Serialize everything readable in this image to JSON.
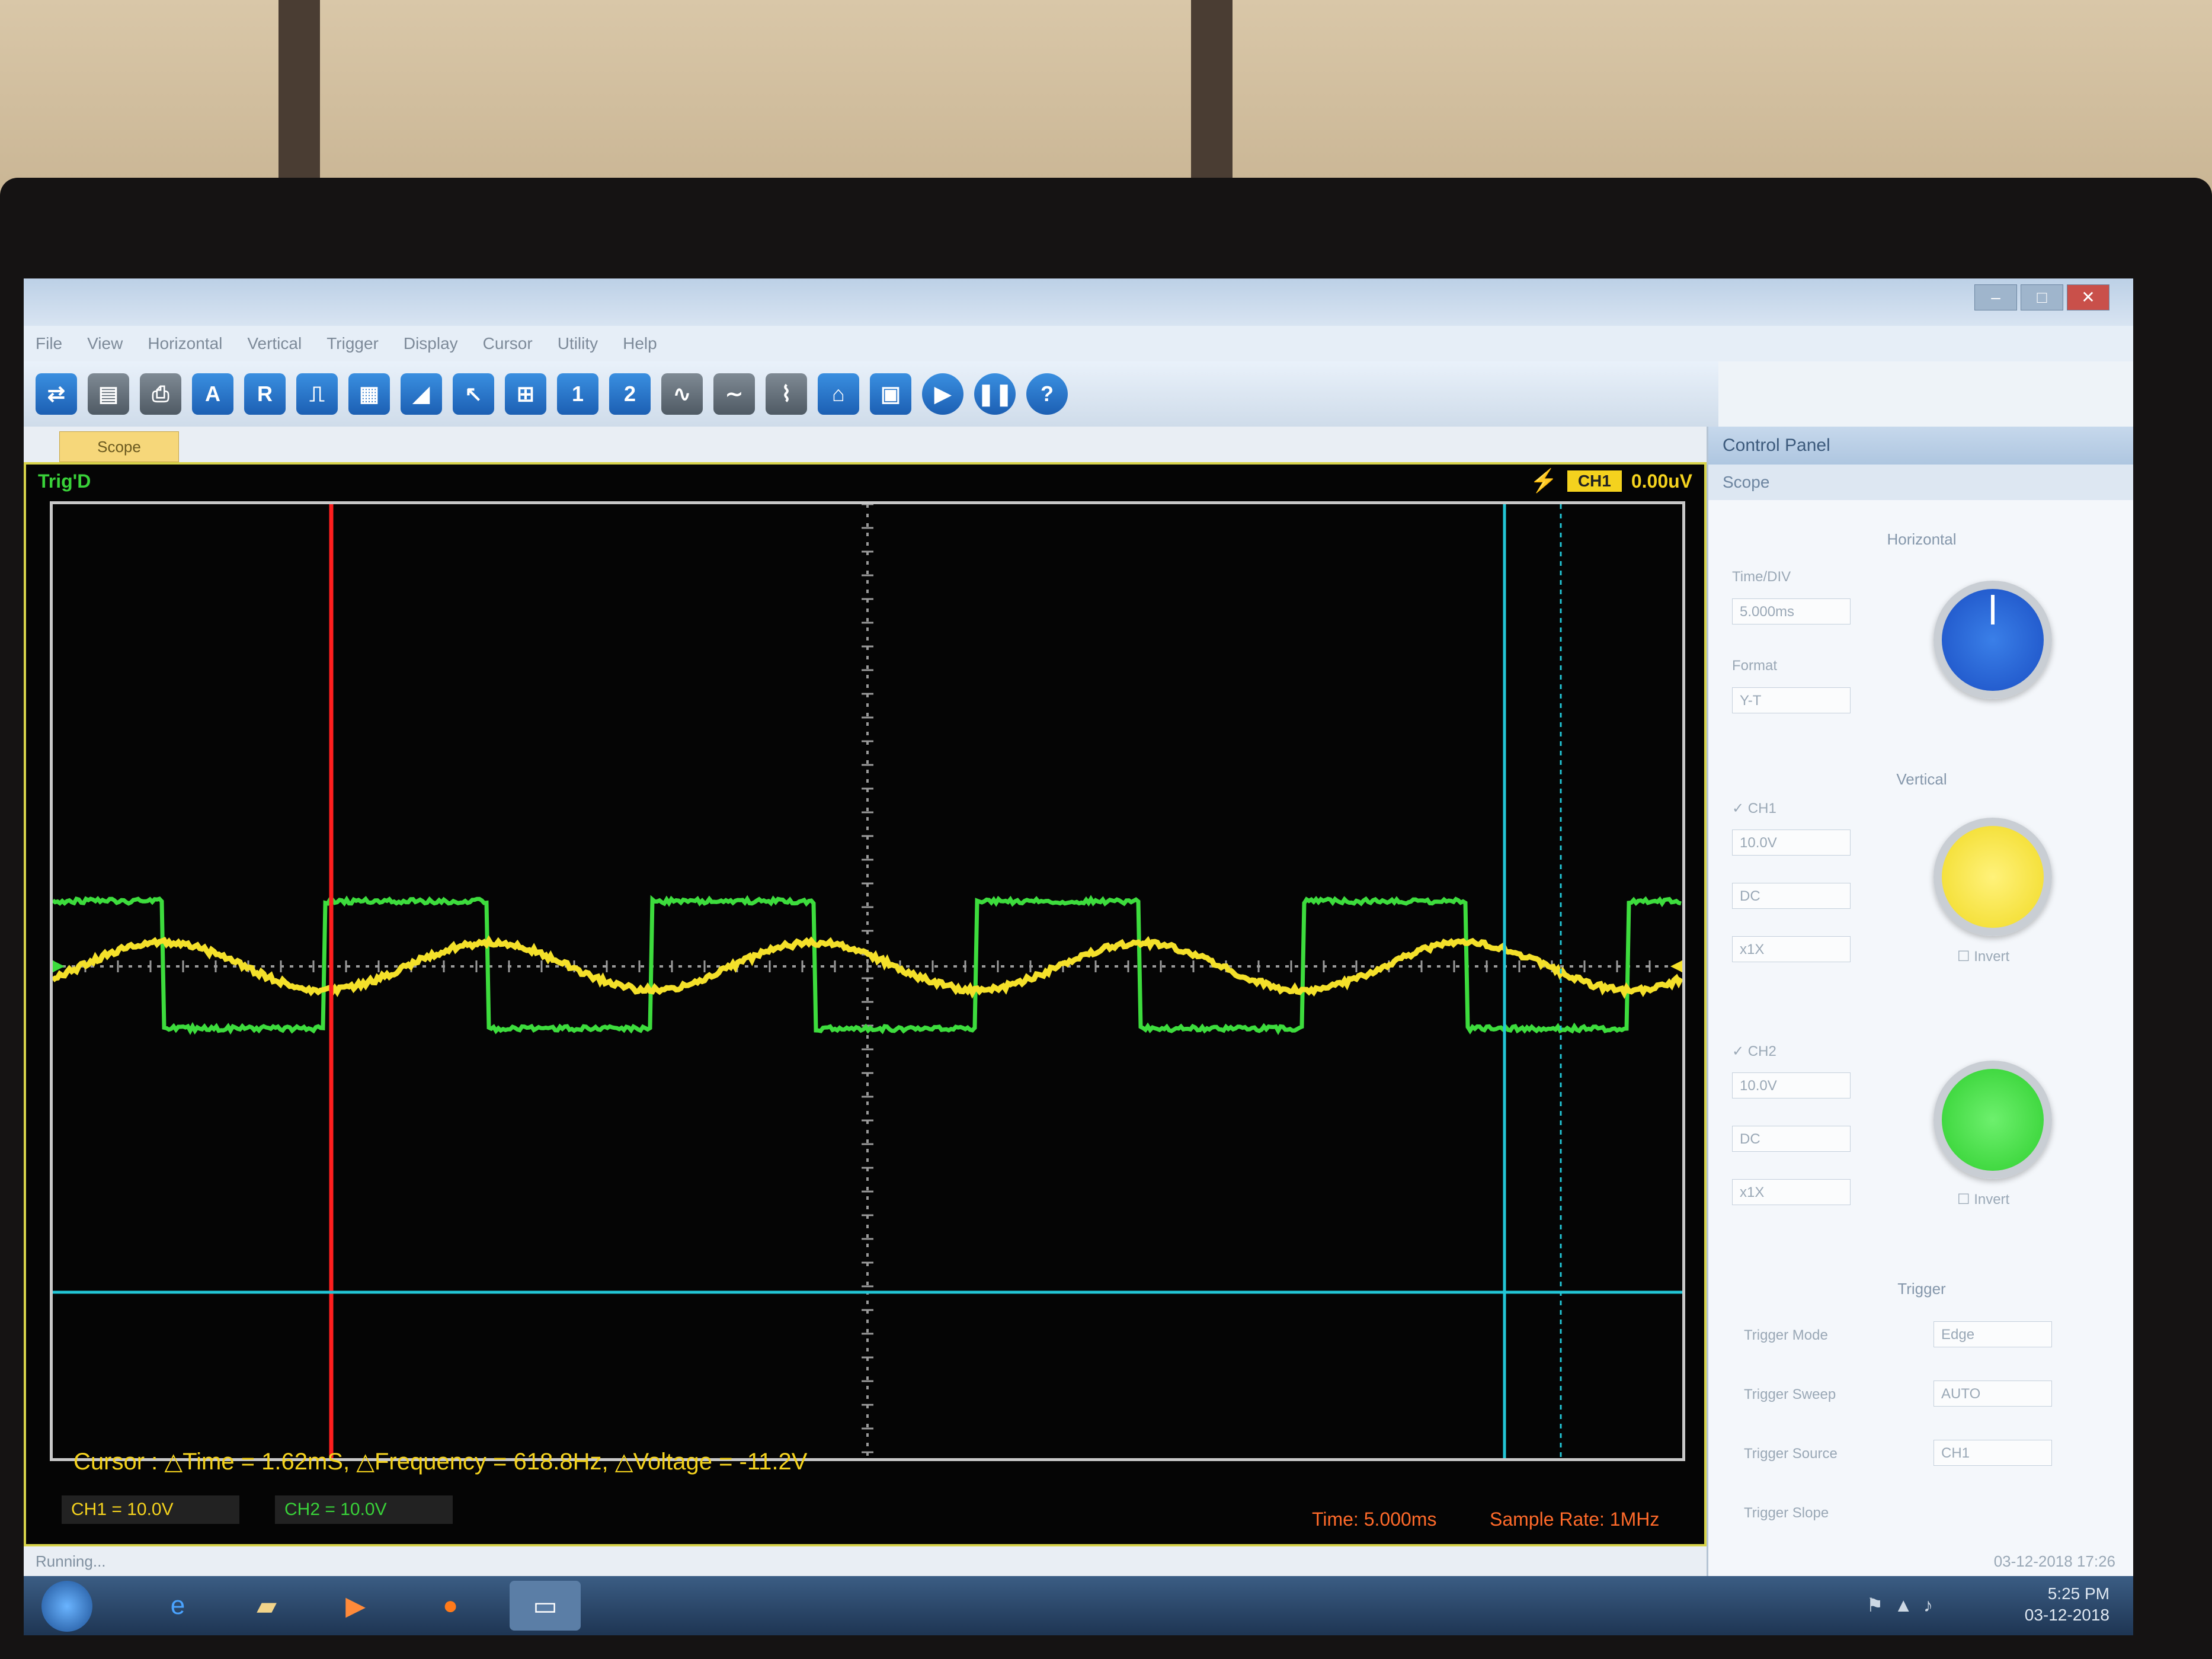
{
  "window": {
    "minimize": "–",
    "maximize": "□",
    "close": "✕"
  },
  "menu": [
    "File",
    "View",
    "Horizontal",
    "Vertical",
    "Trigger",
    "Display",
    "Cursor",
    "Utility",
    "Help"
  ],
  "toolbar_icons": [
    "connect-icon",
    "save-icon",
    "print-icon",
    "auto-icon",
    "reset-icon",
    "pulse-icon",
    "measure-icon",
    "ramp-icon",
    "cursor-icon",
    "zoom-icon",
    "channel1-icon",
    "channel2-icon",
    "waveform-a-icon",
    "waveform-b-icon",
    "waveform-c-icon",
    "home-icon",
    "record-icon",
    "run-icon",
    "stop-icon",
    "help-icon"
  ],
  "tab": {
    "label": "Scope"
  },
  "scope": {
    "trig_status": "Trig'D",
    "trig_badge": "CH1",
    "trig_level": "0.00uV",
    "cursor_readout": "Cursor : △Time = 1.62mS, △Frequency = 618.8Hz, △Voltage = -11.2V",
    "ch1_scale": "CH1 = 10.0V",
    "ch2_scale": "CH2 = 10.0V",
    "time_readout": "Time: 5.000ms",
    "sample_rate": "Sample Rate: 1MHz",
    "colors": {
      "ch1": "#f4e02a",
      "ch2": "#3ddc3d",
      "cursor_v1": "#ff1e1e",
      "cursor_teal": "#22c6d6",
      "grid": "#9a9a9a"
    }
  },
  "status": {
    "text": "Running..."
  },
  "panel": {
    "title": "Control Panel",
    "subtitle": "Scope",
    "horizontal": {
      "section": "Horizontal",
      "timediv_label": "Time/DIV",
      "timediv_value": "5.000ms",
      "format_label": "Format",
      "format_value": "Y-T"
    },
    "vertical": {
      "section": "Vertical",
      "ch1_label": "CH1",
      "ch1_volt": "10.0V",
      "ch1_coupling": "DC",
      "ch1_probe": "x1X",
      "ch1_invert": "Invert",
      "ch2_label": "CH2",
      "ch2_volt": "10.0V",
      "ch2_coupling": "DC",
      "ch2_probe": "x1X",
      "ch2_invert": "Invert"
    },
    "trigger": {
      "section": "Trigger",
      "mode_label": "Trigger Mode",
      "mode_value": "Edge",
      "sweep_label": "Trigger Sweep",
      "sweep_value": "AUTO",
      "source_label": "Trigger Source",
      "source_value": "CH1",
      "slope_label": "Trigger Slope"
    }
  },
  "taskbar": {
    "apps": [
      "ie-icon",
      "explorer-icon",
      "media-player-icon",
      "firefox-icon",
      "scope-app-icon"
    ],
    "time": "5:25 PM",
    "date": "03-12-2018"
  },
  "overlay_datetime": "03-12-2018 17:26"
}
